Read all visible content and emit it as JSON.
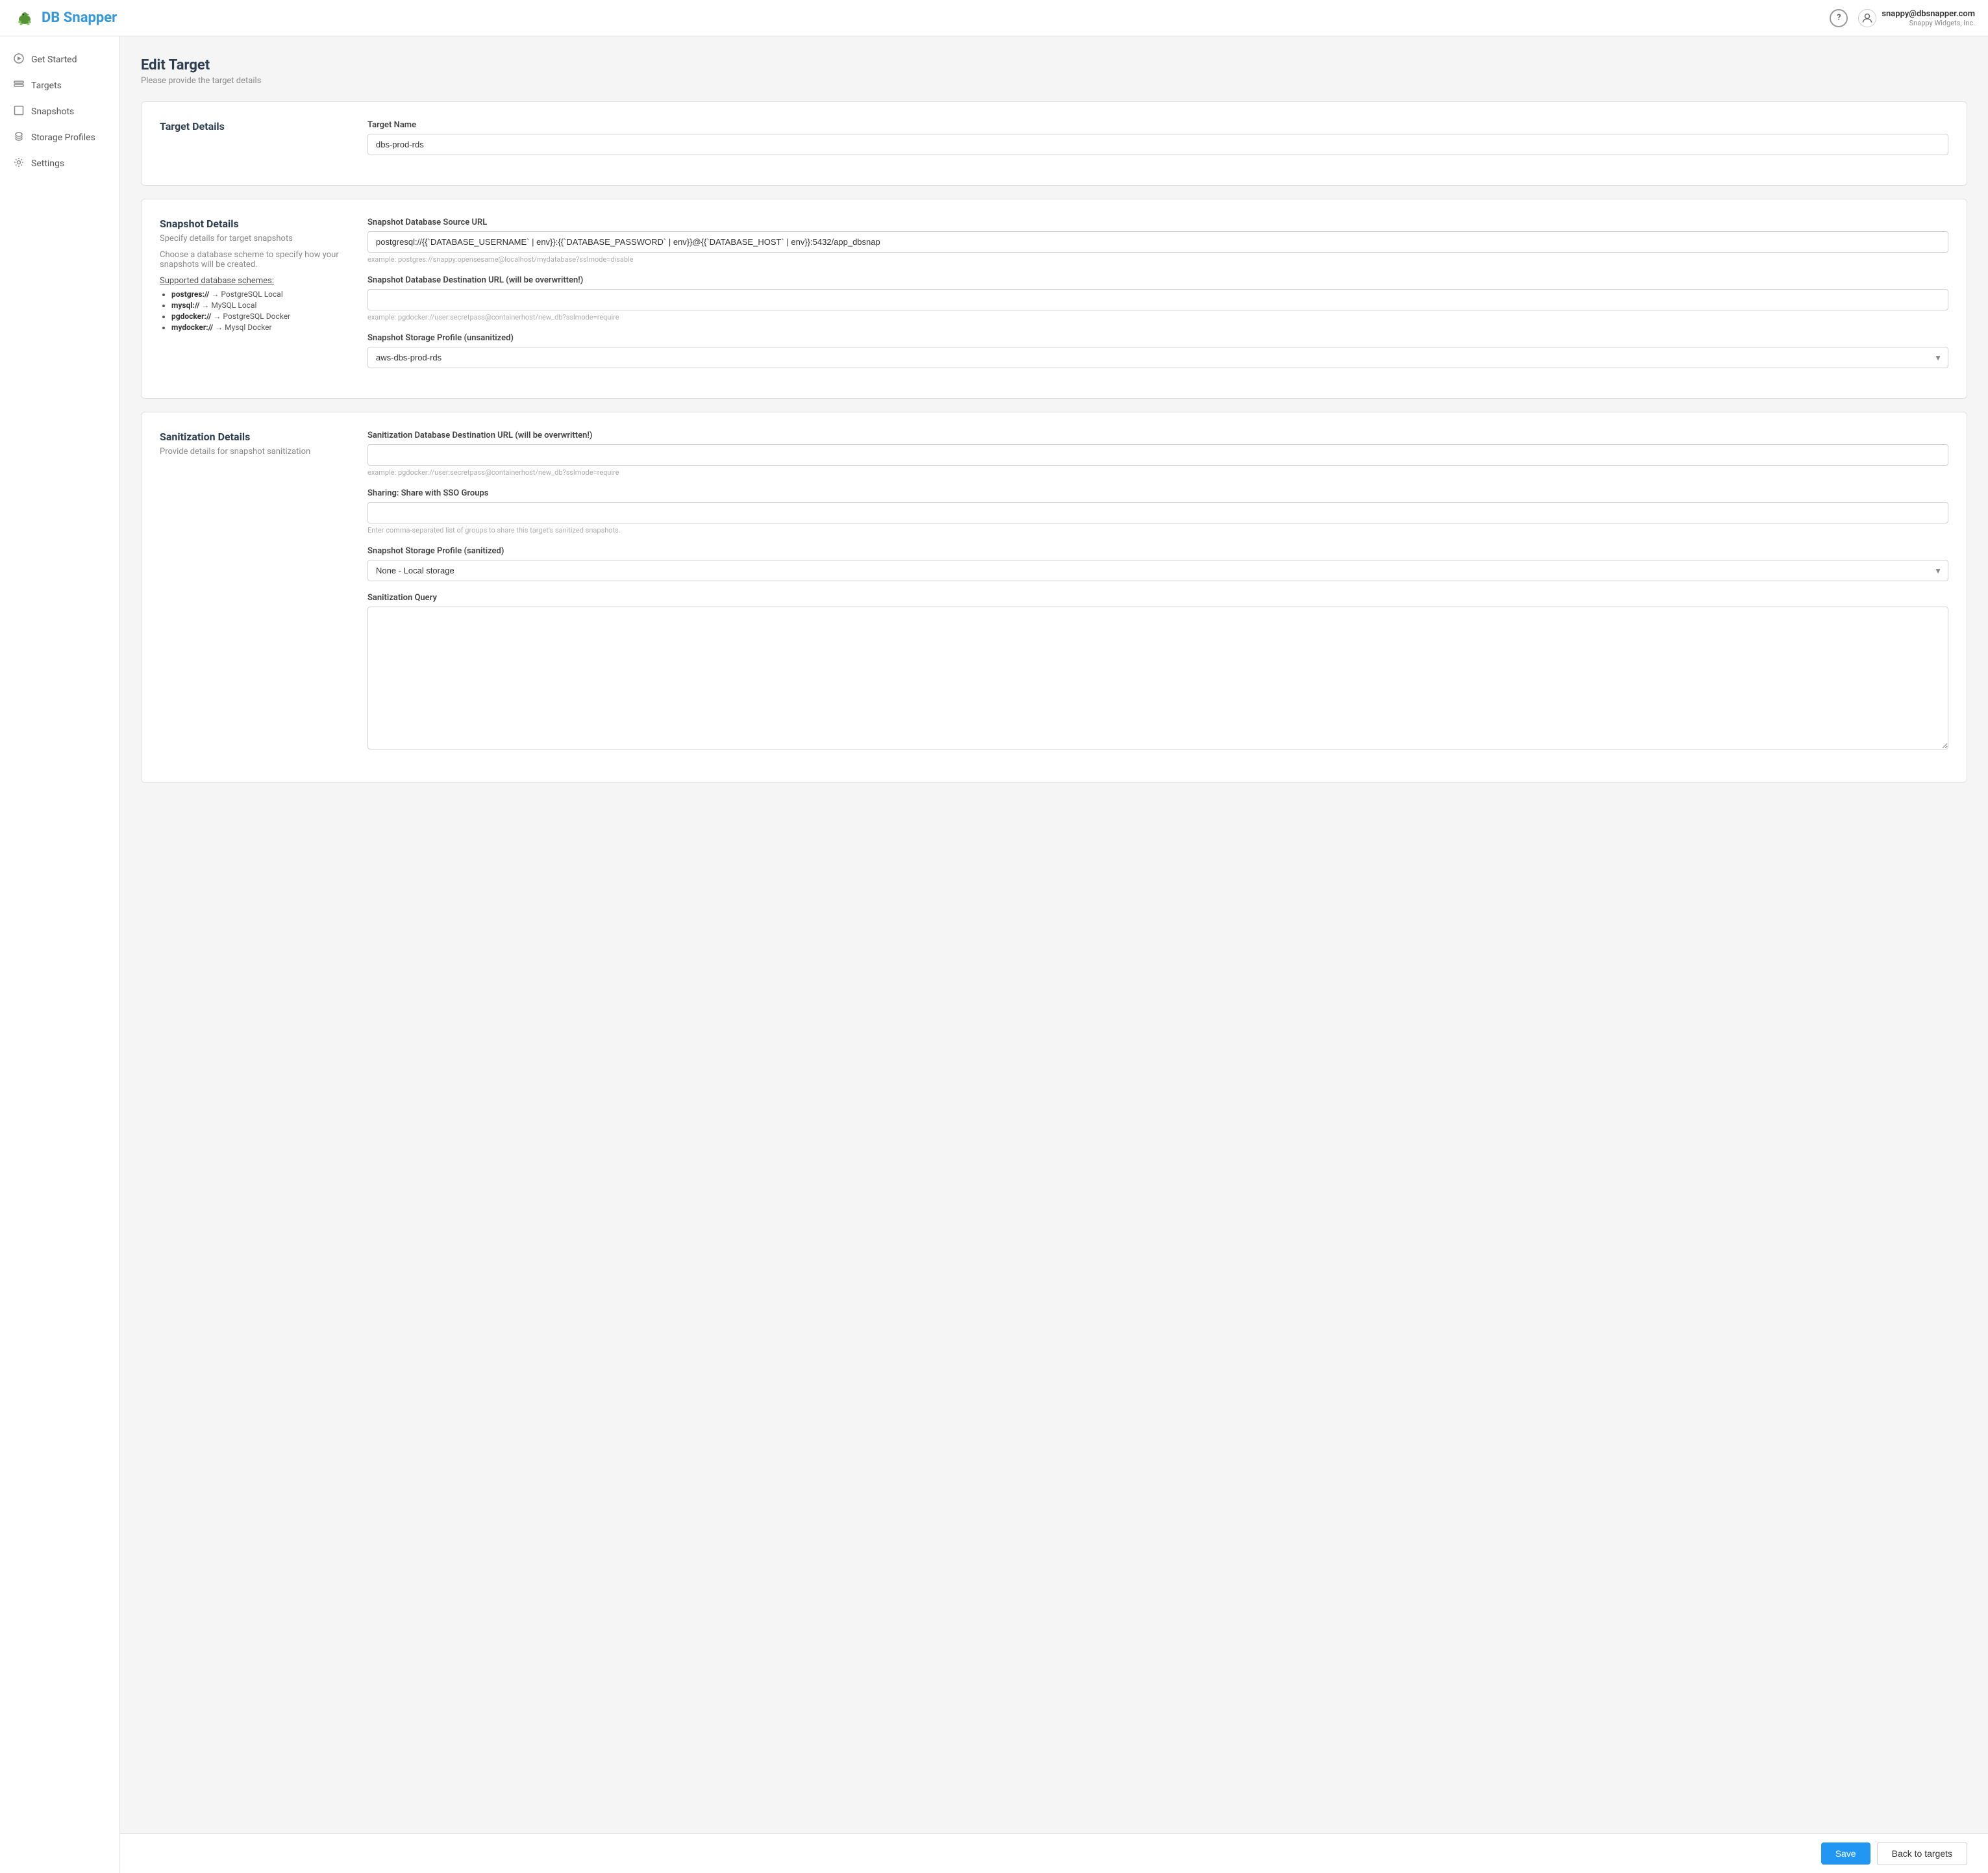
{
  "topbar": {
    "logo_text_db": "DB",
    "logo_text_snapper": " Snapper",
    "help_icon": "?",
    "user_email": "snappy@dbsnapper.com",
    "user_company": "Snappy Widgets, Inc."
  },
  "sidebar": {
    "items": [
      {
        "id": "get-started",
        "label": "Get Started",
        "icon": "▷"
      },
      {
        "id": "targets",
        "label": "Targets",
        "icon": "⊟"
      },
      {
        "id": "snapshots",
        "label": "Snapshots",
        "icon": "◻"
      },
      {
        "id": "storage-profiles",
        "label": "Storage Profiles",
        "icon": "☁"
      },
      {
        "id": "settings",
        "label": "Settings",
        "icon": "⚙"
      }
    ]
  },
  "page": {
    "title": "Edit Target",
    "subtitle": "Please provide the target details"
  },
  "target_details_card": {
    "section_title": "Target Details",
    "target_name_label": "Target Name",
    "target_name_value": "dbs-prod-rds",
    "target_name_placeholder": ""
  },
  "snapshot_details_card": {
    "section_title": "Snapshot Details",
    "section_desc": "Specify details for target snapshots",
    "section_desc2": "Choose a database scheme to specify how your snapshots will be created.",
    "supported_schemes_title": "Supported database schemes:",
    "schemes": [
      {
        "key": "postgres://",
        "value": "PostgreSQL Local"
      },
      {
        "key": "mysql://",
        "value": "MySQL Local"
      },
      {
        "key": "pgdocker://",
        "value": "PostgreSQL Docker"
      },
      {
        "key": "mydocker://",
        "value": "Mysql Docker"
      }
    ],
    "source_url_label": "Snapshot Database Source URL",
    "source_url_value": "postgresql://{{`DATABASE_USERNAME` | env}}:{{`DATABASE_PASSWORD` | env}}@{{`DATABASE_HOST` | env}}:5432/app_dbsnap",
    "source_url_placeholder": "",
    "dest_url_label": "Snapshot Database Destination URL (will be overwritten!)",
    "dest_url_value": "",
    "dest_url_placeholder": "",
    "dest_url_hint": "example: pgdocker://user:secretpass@containerhost/new_db?sslmode=require",
    "source_url_hint": "example: postgres://snappy:opensesame@localhost/mydatabase?sslmode=disable",
    "storage_profile_label": "Snapshot Storage Profile (unsanitized)",
    "storage_profile_value": "aws-dbs-prod-rds",
    "storage_profile_options": [
      {
        "value": "aws-dbs-prod-rds",
        "label": "aws-dbs-prod-rds"
      },
      {
        "value": "none-local",
        "label": "None - Local storage"
      }
    ]
  },
  "sanitization_details_card": {
    "section_title": "Sanitization Details",
    "section_desc": "Provide details for snapshot sanitization",
    "dest_url_label": "Sanitization Database Destination URL (will be overwritten!)",
    "dest_url_value": "",
    "dest_url_placeholder": "",
    "dest_url_hint": "example: pgdocker://user:secretpass@containerhost/new_db?sslmode=require",
    "sharing_label": "Sharing: Share with SSO Groups",
    "sharing_value": "",
    "sharing_placeholder": "",
    "sharing_hint": "Enter comma-separated list of groups to share this target's sanitized snapshots.",
    "storage_profile_label": "Snapshot Storage Profile (sanitized)",
    "storage_profile_value": "none-local",
    "storage_profile_options": [
      {
        "value": "none-local",
        "label": "None - Local storage"
      },
      {
        "value": "aws-dbs-prod-rds",
        "label": "aws-dbs-prod-rds"
      }
    ],
    "sanitization_query_label": "Sanitization Query",
    "sanitization_query_value": ""
  },
  "bottom_bar": {
    "save_label": "Save",
    "back_label": "Back to targets"
  }
}
